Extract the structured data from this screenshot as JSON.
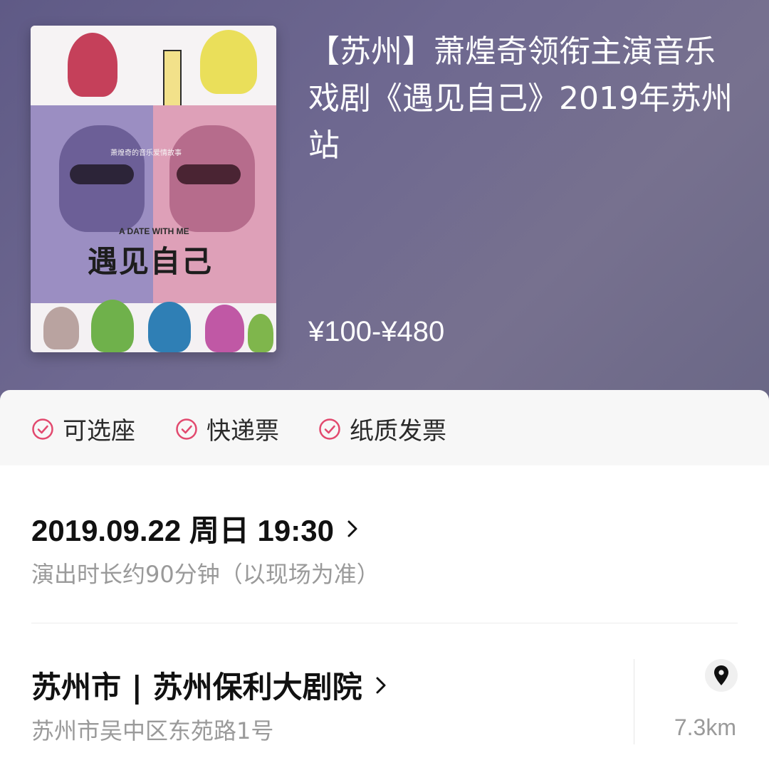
{
  "show": {
    "title": "【苏州】萧煌奇领衔主演音乐戏剧《遇见自己》2019年苏州站",
    "price_range": "¥100-¥480",
    "poster": {
      "title_en": "A DATE WITH ME",
      "title_zh": "遇见自己",
      "tagline": "萧煌奇的音乐爱情故事"
    }
  },
  "tags": [
    "可选座",
    "快递票",
    "纸质发票"
  ],
  "session": {
    "datetime": "2019.09.22 周日 19:30",
    "duration": "演出时长约90分钟（以现场为准）"
  },
  "venue": {
    "name": "苏州市 | 苏州保利大剧院",
    "address": "苏州市吴中区东苑路1号",
    "distance": "7.3km"
  },
  "colors": {
    "accent": "#e2496e",
    "hero_bg": "#6b6690"
  }
}
